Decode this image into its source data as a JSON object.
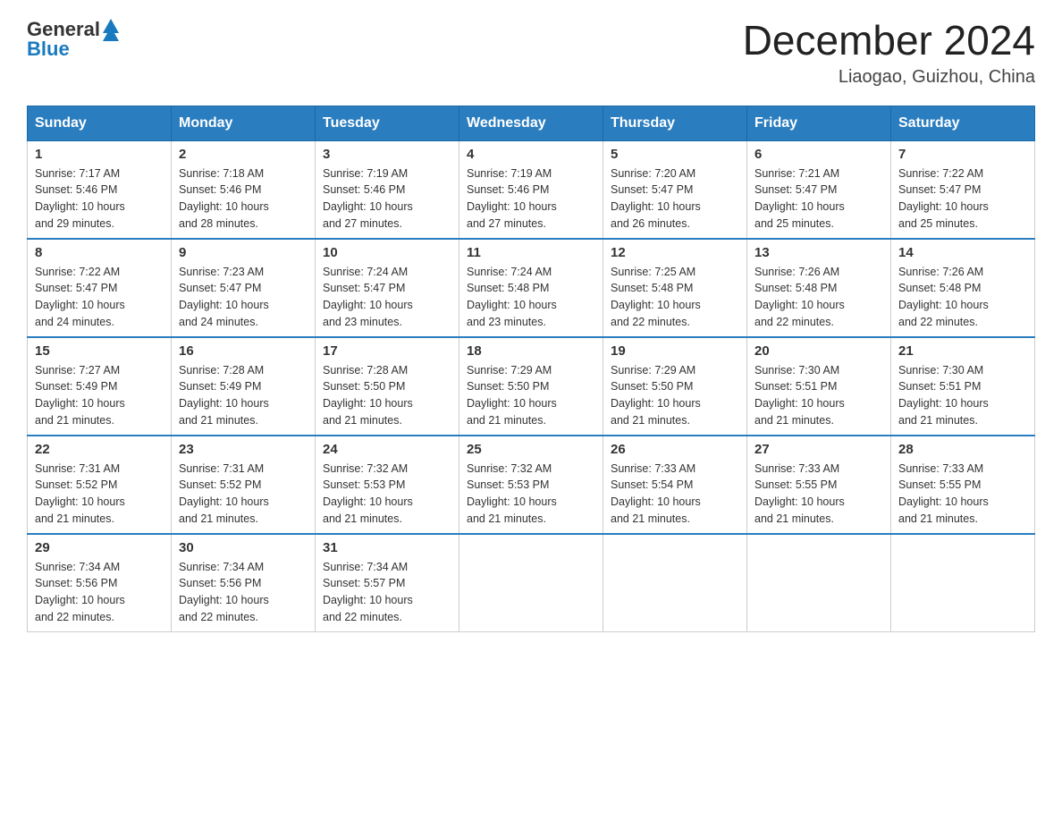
{
  "header": {
    "logo_general": "General",
    "logo_blue": "Blue",
    "month_title": "December 2024",
    "location": "Liaogao, Guizhou, China"
  },
  "weekdays": [
    "Sunday",
    "Monday",
    "Tuesday",
    "Wednesday",
    "Thursday",
    "Friday",
    "Saturday"
  ],
  "weeks": [
    [
      {
        "day": "1",
        "sunrise": "7:17 AM",
        "sunset": "5:46 PM",
        "daylight": "10 hours and 29 minutes."
      },
      {
        "day": "2",
        "sunrise": "7:18 AM",
        "sunset": "5:46 PM",
        "daylight": "10 hours and 28 minutes."
      },
      {
        "day": "3",
        "sunrise": "7:19 AM",
        "sunset": "5:46 PM",
        "daylight": "10 hours and 27 minutes."
      },
      {
        "day": "4",
        "sunrise": "7:19 AM",
        "sunset": "5:46 PM",
        "daylight": "10 hours and 27 minutes."
      },
      {
        "day": "5",
        "sunrise": "7:20 AM",
        "sunset": "5:47 PM",
        "daylight": "10 hours and 26 minutes."
      },
      {
        "day": "6",
        "sunrise": "7:21 AM",
        "sunset": "5:47 PM",
        "daylight": "10 hours and 25 minutes."
      },
      {
        "day": "7",
        "sunrise": "7:22 AM",
        "sunset": "5:47 PM",
        "daylight": "10 hours and 25 minutes."
      }
    ],
    [
      {
        "day": "8",
        "sunrise": "7:22 AM",
        "sunset": "5:47 PM",
        "daylight": "10 hours and 24 minutes."
      },
      {
        "day": "9",
        "sunrise": "7:23 AM",
        "sunset": "5:47 PM",
        "daylight": "10 hours and 24 minutes."
      },
      {
        "day": "10",
        "sunrise": "7:24 AM",
        "sunset": "5:47 PM",
        "daylight": "10 hours and 23 minutes."
      },
      {
        "day": "11",
        "sunrise": "7:24 AM",
        "sunset": "5:48 PM",
        "daylight": "10 hours and 23 minutes."
      },
      {
        "day": "12",
        "sunrise": "7:25 AM",
        "sunset": "5:48 PM",
        "daylight": "10 hours and 22 minutes."
      },
      {
        "day": "13",
        "sunrise": "7:26 AM",
        "sunset": "5:48 PM",
        "daylight": "10 hours and 22 minutes."
      },
      {
        "day": "14",
        "sunrise": "7:26 AM",
        "sunset": "5:48 PM",
        "daylight": "10 hours and 22 minutes."
      }
    ],
    [
      {
        "day": "15",
        "sunrise": "7:27 AM",
        "sunset": "5:49 PM",
        "daylight": "10 hours and 21 minutes."
      },
      {
        "day": "16",
        "sunrise": "7:28 AM",
        "sunset": "5:49 PM",
        "daylight": "10 hours and 21 minutes."
      },
      {
        "day": "17",
        "sunrise": "7:28 AM",
        "sunset": "5:50 PM",
        "daylight": "10 hours and 21 minutes."
      },
      {
        "day": "18",
        "sunrise": "7:29 AM",
        "sunset": "5:50 PM",
        "daylight": "10 hours and 21 minutes."
      },
      {
        "day": "19",
        "sunrise": "7:29 AM",
        "sunset": "5:50 PM",
        "daylight": "10 hours and 21 minutes."
      },
      {
        "day": "20",
        "sunrise": "7:30 AM",
        "sunset": "5:51 PM",
        "daylight": "10 hours and 21 minutes."
      },
      {
        "day": "21",
        "sunrise": "7:30 AM",
        "sunset": "5:51 PM",
        "daylight": "10 hours and 21 minutes."
      }
    ],
    [
      {
        "day": "22",
        "sunrise": "7:31 AM",
        "sunset": "5:52 PM",
        "daylight": "10 hours and 21 minutes."
      },
      {
        "day": "23",
        "sunrise": "7:31 AM",
        "sunset": "5:52 PM",
        "daylight": "10 hours and 21 minutes."
      },
      {
        "day": "24",
        "sunrise": "7:32 AM",
        "sunset": "5:53 PM",
        "daylight": "10 hours and 21 minutes."
      },
      {
        "day": "25",
        "sunrise": "7:32 AM",
        "sunset": "5:53 PM",
        "daylight": "10 hours and 21 minutes."
      },
      {
        "day": "26",
        "sunrise": "7:33 AM",
        "sunset": "5:54 PM",
        "daylight": "10 hours and 21 minutes."
      },
      {
        "day": "27",
        "sunrise": "7:33 AM",
        "sunset": "5:55 PM",
        "daylight": "10 hours and 21 minutes."
      },
      {
        "day": "28",
        "sunrise": "7:33 AM",
        "sunset": "5:55 PM",
        "daylight": "10 hours and 21 minutes."
      }
    ],
    [
      {
        "day": "29",
        "sunrise": "7:34 AM",
        "sunset": "5:56 PM",
        "daylight": "10 hours and 22 minutes."
      },
      {
        "day": "30",
        "sunrise": "7:34 AM",
        "sunset": "5:56 PM",
        "daylight": "10 hours and 22 minutes."
      },
      {
        "day": "31",
        "sunrise": "7:34 AM",
        "sunset": "5:57 PM",
        "daylight": "10 hours and 22 minutes."
      },
      null,
      null,
      null,
      null
    ]
  ]
}
